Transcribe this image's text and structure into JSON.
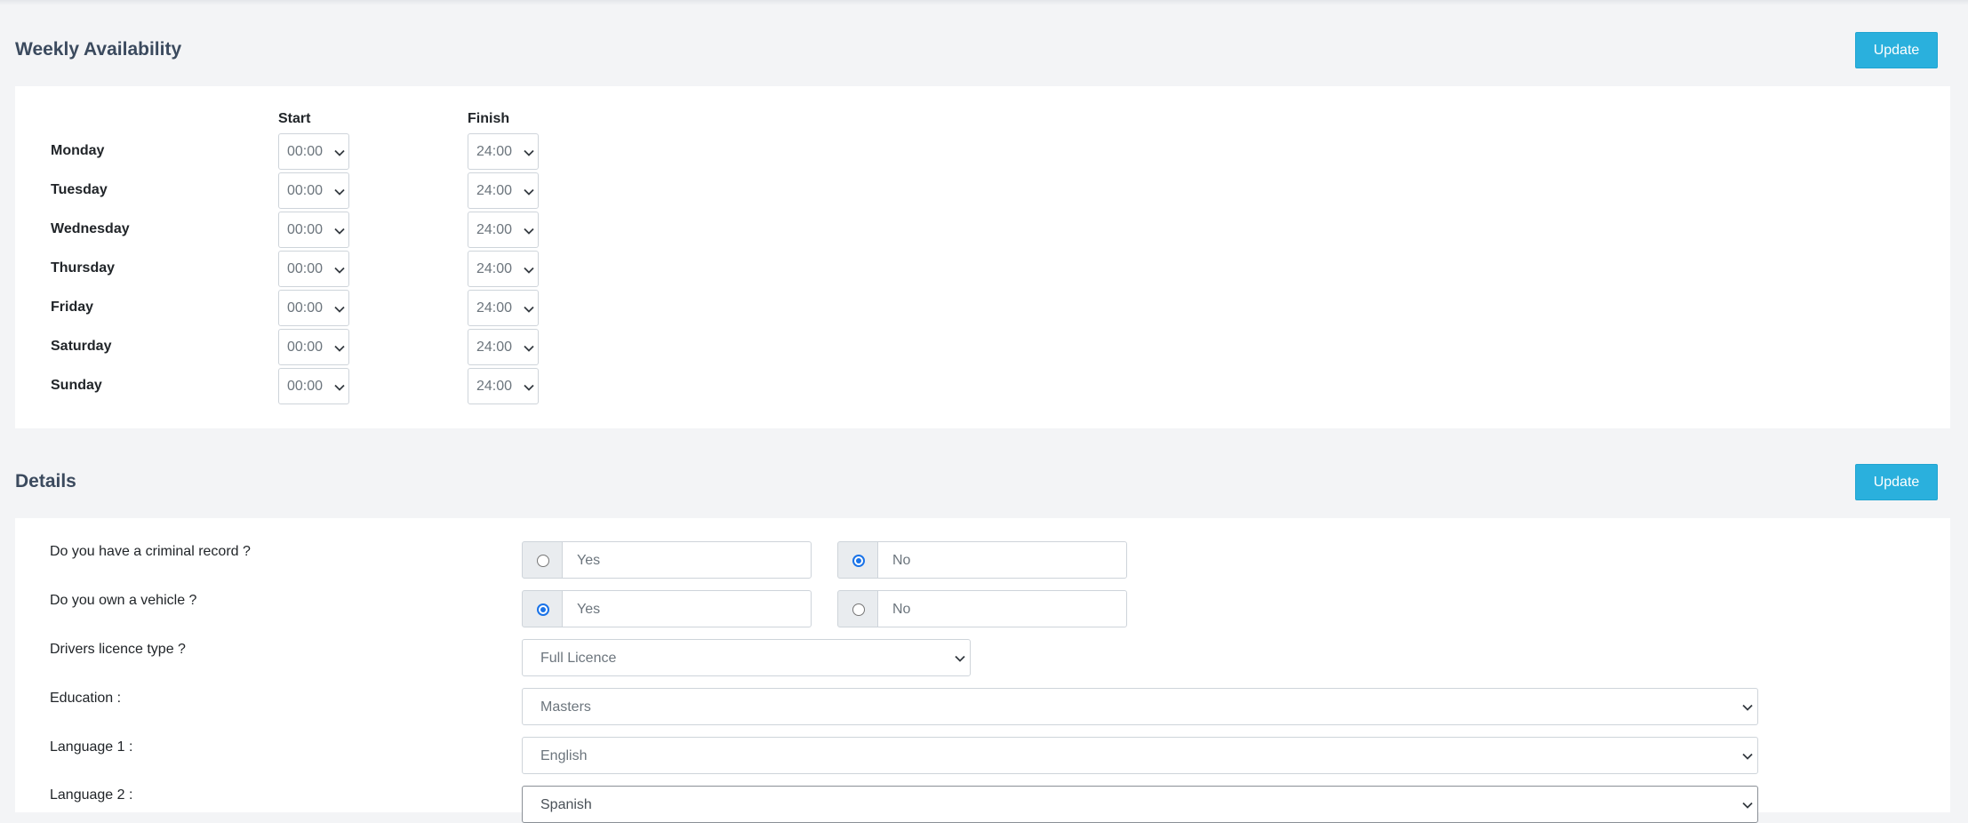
{
  "availability": {
    "title": "Weekly Availability",
    "update_label": "Update",
    "start_header": "Start",
    "finish_header": "Finish",
    "days": [
      {
        "day": "Monday",
        "start": "00:00",
        "finish": "24:00"
      },
      {
        "day": "Tuesday",
        "start": "00:00",
        "finish": "24:00"
      },
      {
        "day": "Wednesday",
        "start": "00:00",
        "finish": "24:00"
      },
      {
        "day": "Thursday",
        "start": "00:00",
        "finish": "24:00"
      },
      {
        "day": "Friday",
        "start": "00:00",
        "finish": "24:00"
      },
      {
        "day": "Saturday",
        "start": "00:00",
        "finish": "24:00"
      },
      {
        "day": "Sunday",
        "start": "00:00",
        "finish": "24:00"
      }
    ]
  },
  "details": {
    "title": "Details",
    "update_label": "Update",
    "criminal_record": {
      "label": "Do you have a criminal record ?",
      "yes_label": "Yes",
      "no_label": "No",
      "selected": "No"
    },
    "own_vehicle": {
      "label": "Do you own a vehicle ?",
      "yes_label": "Yes",
      "no_label": "No",
      "selected": "Yes"
    },
    "licence": {
      "label": "Drivers licence type ?",
      "value": "Full Licence"
    },
    "education": {
      "label": "Education :",
      "value": "Masters"
    },
    "language1": {
      "label": "Language 1 :",
      "value": "English"
    },
    "language2": {
      "label": "Language 2 :",
      "value": "Spanish"
    }
  },
  "icons": {
    "dropdown": "chevron-down-icon",
    "radio": "radio-button-icon"
  }
}
